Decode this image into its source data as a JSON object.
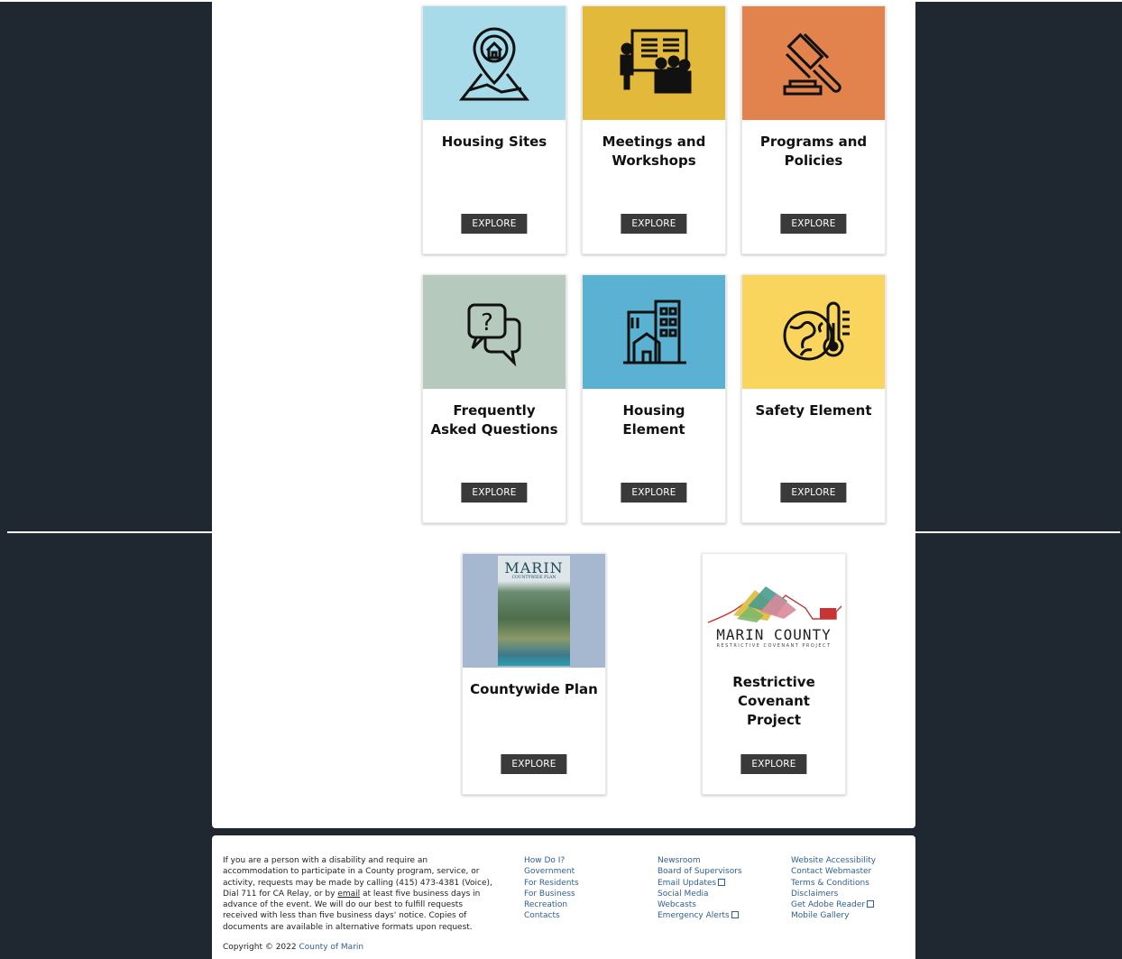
{
  "cards": [
    {
      "title": "Housing Sites",
      "button": "EXPLORE",
      "bg": "#a8dbe9",
      "icon": "map-pin-house-icon"
    },
    {
      "title": "Meetings and Workshops",
      "button": "EXPLORE",
      "bg": "#e3b93b",
      "icon": "presentation-audience-icon"
    },
    {
      "title": "Programs and Policies",
      "button": "EXPLORE",
      "bg": "#e2834e",
      "icon": "gavel-icon"
    },
    {
      "title": "Frequently Asked Questions",
      "button": "EXPLORE",
      "bg": "#b5c9bd",
      "icon": "question-chat-icon"
    },
    {
      "title": "Housing Element",
      "button": "EXPLORE",
      "bg": "#5bb1d1",
      "icon": "buildings-icon"
    },
    {
      "title": "Safety Element",
      "button": "EXPLORE",
      "bg": "#f9d55d",
      "icon": "globe-thermometer-icon"
    },
    {
      "title": "Countywide Plan",
      "button": "EXPLORE",
      "bg": "#a6b8d0",
      "icon": "countywide-plan-cover",
      "cover_title": "MARIN",
      "cover_subtitle": "COUNTYWIDE PLAN"
    },
    {
      "title": "Restrictive Covenant Project",
      "button": "EXPLORE",
      "bg": "#ffffff",
      "icon": "restrictive-covenant-logo",
      "logo_title": "MARIN COUNTY",
      "logo_subtitle": "RESTRICTIVE COVENANT PROJECT"
    }
  ],
  "footer": {
    "disclaimer_before": "If you are a person with a disability and require an accommodation to participate in a County program, service, or activity, requests may be made by calling (415) 473-4381 (Voice), Dial 711 for CA Relay, or by ",
    "disclaimer_link": "email",
    "disclaimer_after": " at least five business days in advance of the event. We will do our best to fulfill requests received with less than five business days' notice. Copies of documents are available in alternative formats upon request.",
    "col1": [
      "How Do I?",
      "Government",
      "For Residents",
      "For Business",
      "Recreation",
      "Contacts"
    ],
    "col2": [
      "Newsroom",
      "Board of Supervisors",
      "Email Updates",
      "Social Media",
      "Webcasts",
      "Emergency Alerts"
    ],
    "col3": [
      "Website Accessibility",
      "Contact Webmaster",
      "Terms & Conditions",
      "Disclaimers",
      "Get Adobe Reader",
      "Mobile Gallery"
    ],
    "copyright_prefix": "Copyright © 2022 ",
    "copyright_link": "County of Marin"
  }
}
